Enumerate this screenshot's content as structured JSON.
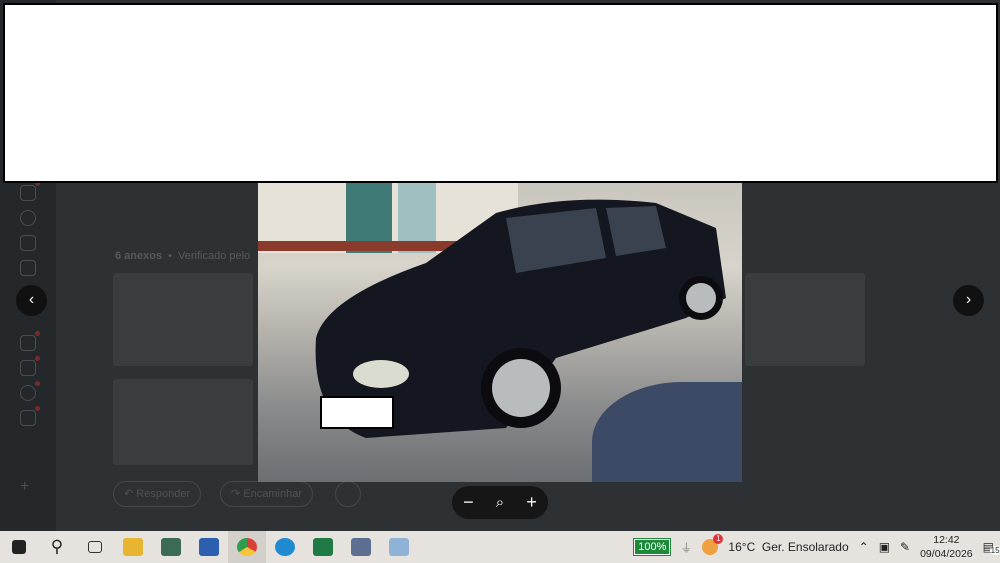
{
  "background": {
    "attachments_label": "6 anexos",
    "verified_label": "Verificado pelo",
    "reply_label": "Responder",
    "forward_label": "Encaminhar"
  },
  "viewer": {
    "prev_icon": "chevron-left-icon",
    "next_icon": "chevron-right-icon",
    "zoom_out": "−",
    "zoom_reset": "⌕",
    "zoom_in": "+"
  },
  "taskbar": {
    "apps": [
      "Start",
      "Search",
      "Task View",
      "File Explorer",
      "WhatsApp",
      "Remote",
      "Chrome",
      "Edge",
      "Excel",
      "Chat",
      "Paint"
    ],
    "battery": "100%",
    "weather_badge": "1",
    "weather": "16°C  Ger. Ensolarado",
    "time": "12:42",
    "date": "09/04/2026",
    "notifications": "15"
  },
  "colors": {
    "taskbar": "#e6e3df",
    "battery": "#1d8a3a",
    "overlay": "#2e3134"
  }
}
